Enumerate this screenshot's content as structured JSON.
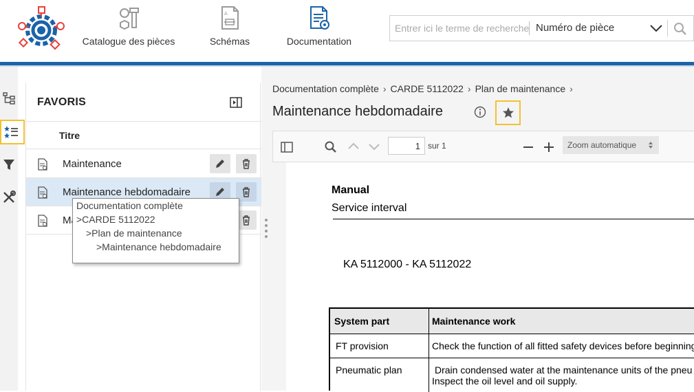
{
  "header": {
    "nav": [
      {
        "label": "Catalogue des pièces",
        "icon": "bolt-nut-icon"
      },
      {
        "label": "Schémas",
        "icon": "schematic-icon"
      },
      {
        "label": "Documentation",
        "icon": "documentation-icon"
      }
    ],
    "search": {
      "placeholder": "Entrer ici le terme de recherche",
      "select_value": "Numéro de pièce"
    }
  },
  "rail": {
    "items": [
      "tree-icon",
      "favorites-list-icon",
      "filter-icon",
      "tools-icon"
    ]
  },
  "favorites": {
    "title": "FAVORIS",
    "column_title": "Titre",
    "rows": [
      {
        "label": "Maintenance"
      },
      {
        "label": "Maintenance hebdomadaire"
      },
      {
        "label": "Ma"
      }
    ],
    "tooltip": [
      "Documentation complète",
      ">CARDE 5112022",
      ">Plan de maintenance",
      ">Maintenance hebdomadaire"
    ]
  },
  "breadcrumb": [
    "Documentation complète",
    "CARDE 5112022",
    "Plan de maintenance"
  ],
  "document": {
    "title": "Maintenance hebdomadaire",
    "page_value": "1",
    "page_of": "sur 1",
    "zoom": "Zoom automatique"
  },
  "page": {
    "manual": "Manual",
    "service_interval": "Service interval",
    "ka_range": "KA 5112000 - KA 5112022",
    "table": {
      "headers": [
        "System part",
        "Maintenance work"
      ],
      "rows": [
        [
          "FT provision",
          "Check the function of all fitted safety devices before beginning"
        ],
        [
          "Pneumatic plan",
          "Drain condensed water at the maintenance units of the pneu",
          "Inspect the oil level and oil supply."
        ]
      ]
    }
  },
  "colors": {
    "brand_blue": "#1b63a8",
    "accent_red": "#e8413a",
    "highlight_yellow": "#f3c131"
  }
}
